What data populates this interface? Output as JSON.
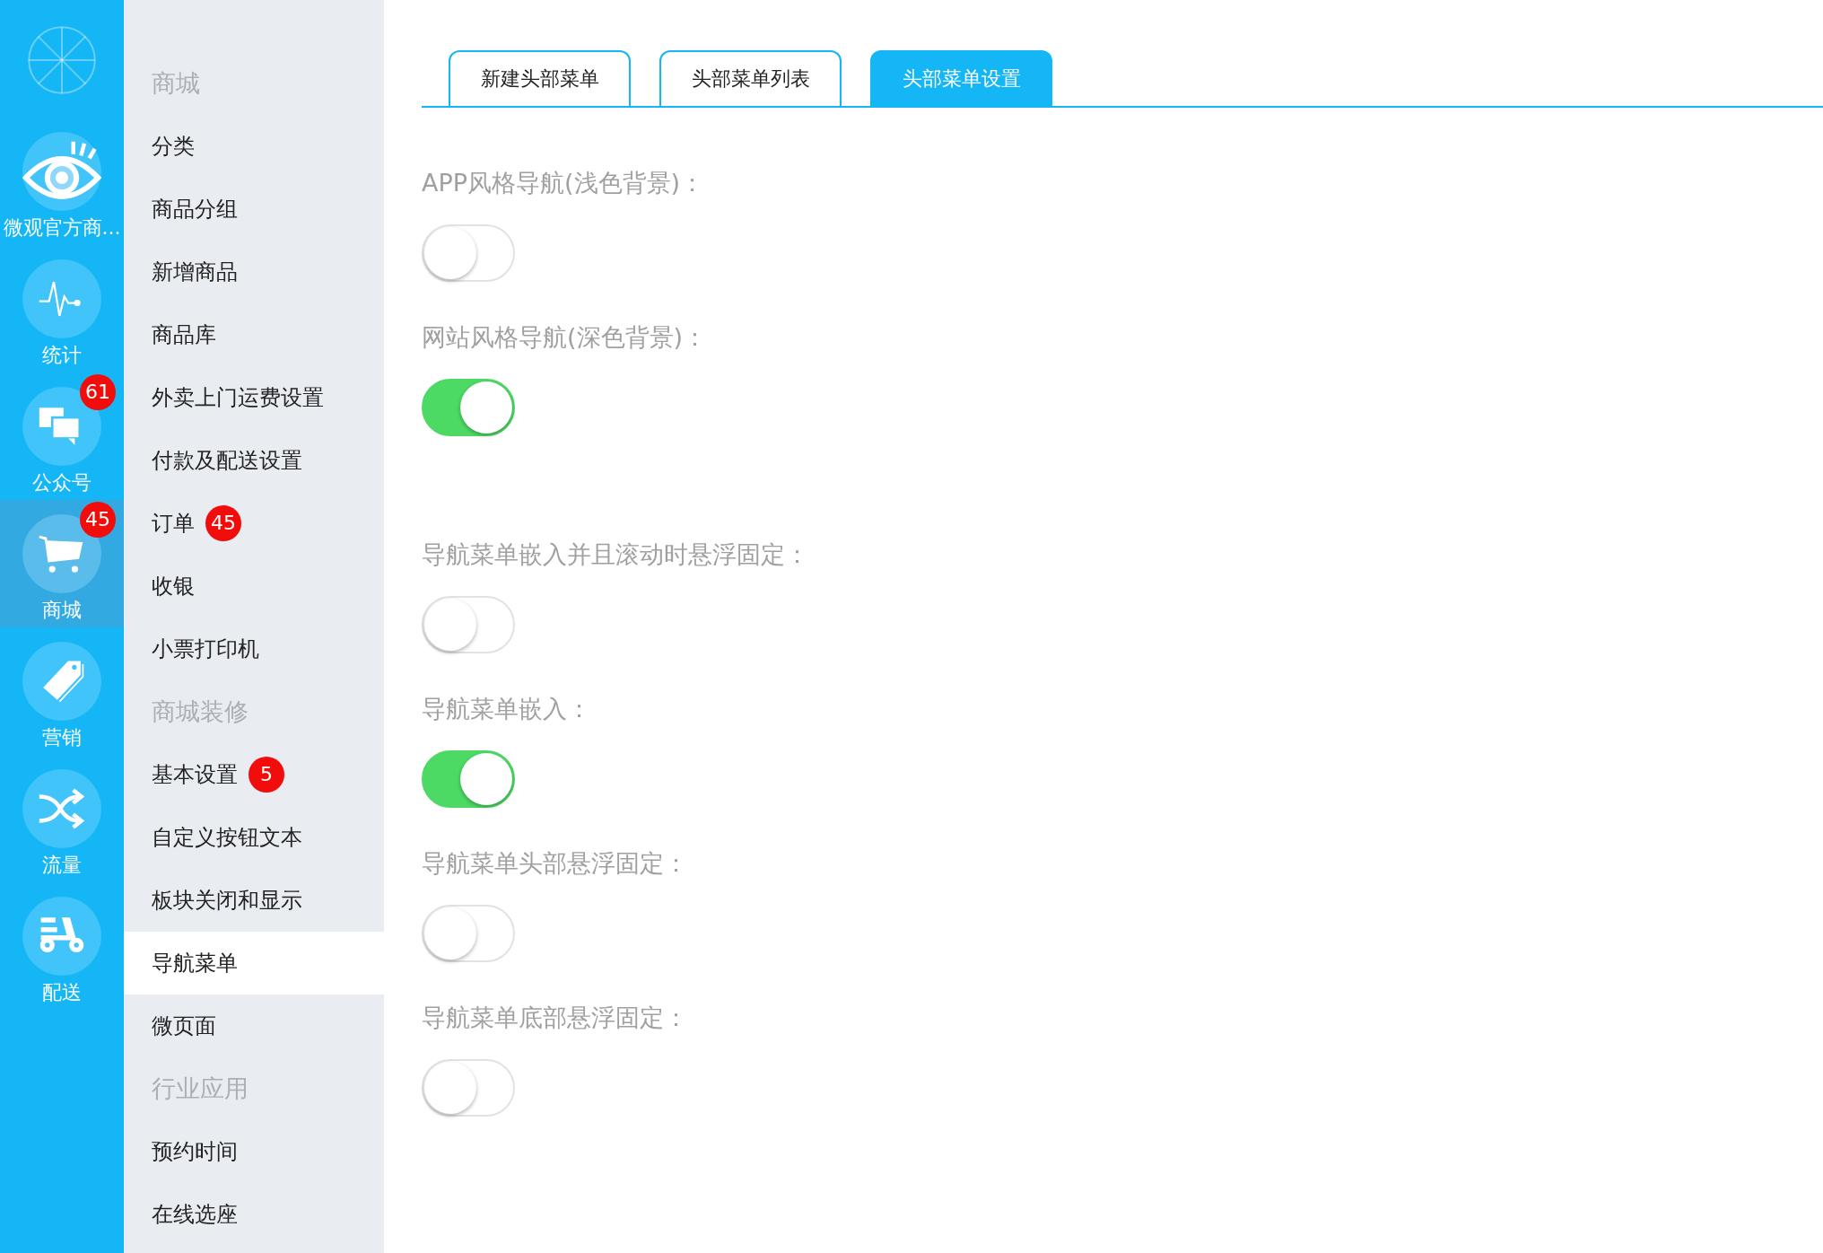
{
  "app_bar": {
    "items": [
      {
        "label": "微观官方商...",
        "selected": false
      },
      {
        "label": "统计",
        "selected": false
      },
      {
        "label": "公众号",
        "badge": "61",
        "selected": false
      },
      {
        "label": "商城",
        "badge": "45",
        "selected": true
      },
      {
        "label": "营销",
        "selected": false
      },
      {
        "label": "流量",
        "selected": false
      },
      {
        "label": "配送",
        "selected": false
      }
    ]
  },
  "sidebar": {
    "items": [
      {
        "kind": "heading",
        "label": "商城"
      },
      {
        "kind": "link",
        "label": "分类",
        "selected": false
      },
      {
        "kind": "link",
        "label": "商品分组",
        "selected": false
      },
      {
        "kind": "link",
        "label": "新增商品",
        "selected": false
      },
      {
        "kind": "link",
        "label": "商品库",
        "selected": false
      },
      {
        "kind": "link",
        "label": "外卖上门运费设置",
        "selected": false
      },
      {
        "kind": "link",
        "label": "付款及配送设置",
        "selected": false
      },
      {
        "kind": "link",
        "label": "订单",
        "badge": "45",
        "selected": false
      },
      {
        "kind": "link",
        "label": "收银",
        "selected": false
      },
      {
        "kind": "link",
        "label": "小票打印机",
        "selected": false
      },
      {
        "kind": "heading",
        "label": "商城装修"
      },
      {
        "kind": "link",
        "label": "基本设置",
        "badge": "5",
        "selected": false
      },
      {
        "kind": "link",
        "label": "自定义按钮文本",
        "selected": false
      },
      {
        "kind": "link",
        "label": "板块关闭和显示",
        "selected": false
      },
      {
        "kind": "link",
        "label": "导航菜单",
        "selected": true
      },
      {
        "kind": "link",
        "label": "微页面",
        "selected": false
      },
      {
        "kind": "heading",
        "label": "行业应用"
      },
      {
        "kind": "link",
        "label": "预约时间",
        "selected": false
      },
      {
        "kind": "link",
        "label": "在线选座",
        "selected": false
      }
    ]
  },
  "tabs": [
    {
      "label": "新建头部菜单",
      "selected": false
    },
    {
      "label": "头部菜单列表",
      "selected": false
    },
    {
      "label": "头部菜单设置",
      "selected": true
    }
  ],
  "settings": [
    {
      "label": "APP风格导航(浅色背景)：",
      "on": false
    },
    {
      "label": "网站风格导航(深色背景)：",
      "on": true
    },
    {
      "label": "导航菜单嵌入并且滚动时悬浮固定：",
      "on": false
    },
    {
      "label": "导航菜单嵌入：",
      "on": true
    },
    {
      "label": "导航菜单头部悬浮固定：",
      "on": false
    },
    {
      "label": "导航菜单底部悬浮固定：",
      "on": false
    }
  ]
}
